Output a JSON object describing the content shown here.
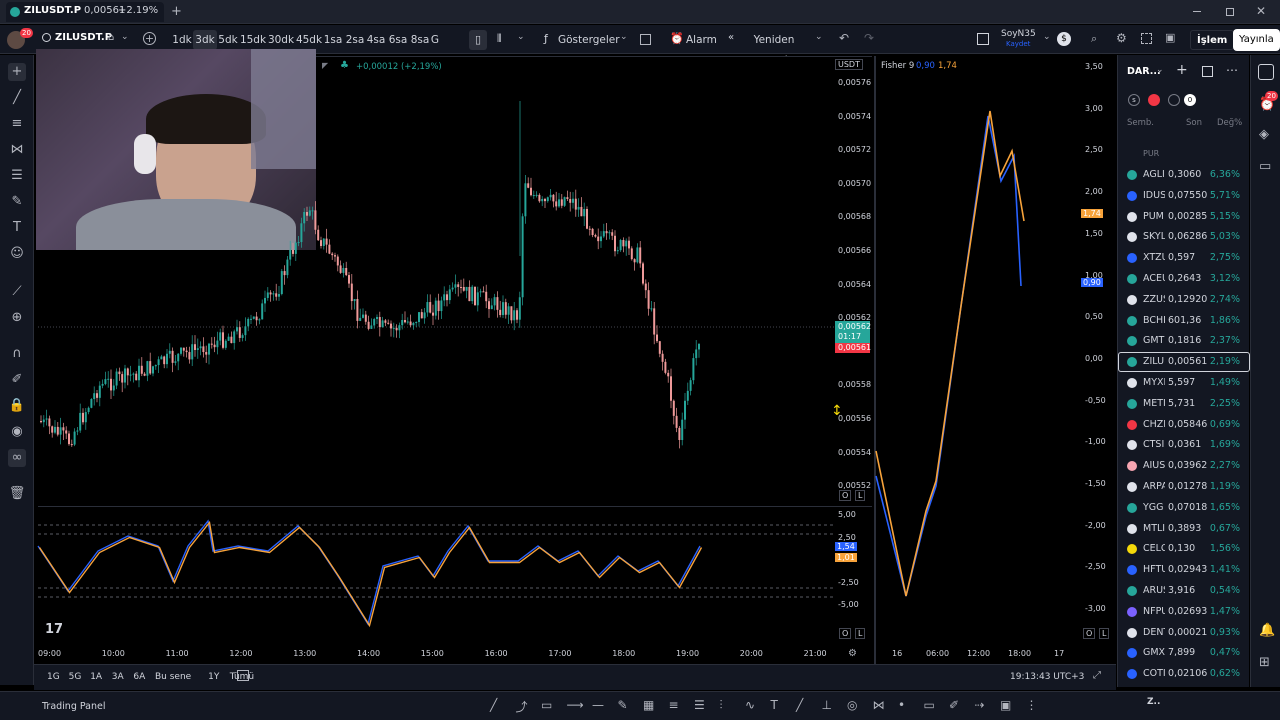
{
  "tab": {
    "title": "ZILUSDT.P",
    "price": "0,00561",
    "change": "+2.19%",
    "plus": "+"
  },
  "toolbar": {
    "symbol": "ZILUSDT.P",
    "intervals": [
      "1dk",
      "3dk",
      "5dk",
      "15dk",
      "30dk",
      "45dk",
      "1sa",
      "2sa",
      "4sa",
      "6sa",
      "8sa",
      "G"
    ],
    "active_interval": "3dk",
    "indicators": "Göstergeler",
    "alarm": "Alarm",
    "replay": "Yeniden oynat",
    "user": "SoyN35",
    "user_sub": "Kaydet",
    "trade": "İşlem",
    "publish": "Yayınla"
  },
  "chart": {
    "change_label": "+0,00012 (+2,19%)",
    "currency": "USDT",
    "price_ticks": [
      "0,00576",
      "0,00574",
      "0,00572",
      "0,00570",
      "0,00568",
      "0,00566",
      "0,00564",
      "0,00562",
      "0,00560",
      "0,00558",
      "0,00556",
      "0,00554",
      "0,00552"
    ],
    "last_price": "0,00562",
    "countdown": "01:17",
    "bid_price": "0,00561",
    "osc_ticks": [
      "5,00",
      "2,50",
      "-2,50",
      "-5,00"
    ],
    "osc_val1": "1,54",
    "osc_val2": "1,01",
    "time_ticks": [
      "09:00",
      "10:00",
      "11:00",
      "12:00",
      "13:00",
      "14:00",
      "15:00",
      "16:00",
      "17:00",
      "18:00",
      "19:00",
      "20:00",
      "21:00"
    ],
    "lock_label": "O",
    "log_label": "L"
  },
  "fisher": {
    "title": "Fisher 9",
    "val1": "0,90",
    "val2": "1,74",
    "ticks": [
      "3,50",
      "3,00",
      "2,50",
      "2,00",
      "1,50",
      "1,00",
      "0,50",
      "0,00",
      "-0,50",
      "-1,00",
      "-1,50",
      "-2,00",
      "-2,50",
      "-3,00"
    ],
    "label_orange": "1,74",
    "label_blue": "0,90",
    "time_ticks": [
      "16",
      "06:00",
      "12:00",
      "18:00",
      "17"
    ],
    "lock_label": "O",
    "log_label": "L"
  },
  "ranges": {
    "items": [
      "1G",
      "5G",
      "1A",
      "3A",
      "6A",
      "Bu sene",
      "1Y",
      "Tümü"
    ],
    "clock": "19:13:43 UTC+3"
  },
  "bottom": {
    "panel": "Trading Panel"
  },
  "watchlist": {
    "title": "DAR...",
    "cols": [
      "Semb.",
      "Son",
      "Değ%"
    ],
    "top_partial": "PUR",
    "rows": [
      {
        "sym": "AGLI",
        "last": "0,3060",
        "chg": "6,36%",
        "color": "#26a69a"
      },
      {
        "sym": "IDUS",
        "last": "0,07550",
        "chg": "5,71%",
        "color": "#2962ff"
      },
      {
        "sym": "PUM",
        "last": "0,00285",
        "chg": "5,15%",
        "color": "#e0e3eb"
      },
      {
        "sym": "SKYL",
        "last": "0,06286",
        "chg": "5,03%",
        "color": "#e0e3eb"
      },
      {
        "sym": "XTZU",
        "last": "0,597",
        "chg": "2,75%",
        "color": "#2962ff"
      },
      {
        "sym": "ACEU",
        "last": "0,2643",
        "chg": "3,12%",
        "color": "#26a69a"
      },
      {
        "sym": "ZZUS",
        "last": "0,12920",
        "chg": "2,74%",
        "color": "#e0e3eb"
      },
      {
        "sym": "BCHI",
        "last": "601,36",
        "chg": "1,86%",
        "color": "#26a69a"
      },
      {
        "sym": "GMT",
        "last": "0,1816",
        "chg": "2,37%",
        "color": "#26a69a"
      },
      {
        "sym": "ZILU",
        "last": "0,00561",
        "chg": "2,19%",
        "color": "#26a69a"
      },
      {
        "sym": "MYXI",
        "last": "5,597",
        "chg": "1,49%",
        "color": "#e0e3eb"
      },
      {
        "sym": "METI",
        "last": "5,731",
        "chg": "2,25%",
        "color": "#26a69a"
      },
      {
        "sym": "CHZI",
        "last": "0,05846",
        "chg": "0,69%",
        "color": "#f23645"
      },
      {
        "sym": "CTSI",
        "last": "0,0361",
        "chg": "1,69%",
        "color": "#e0e3eb"
      },
      {
        "sym": "AIUS",
        "last": "0,03962",
        "chg": "2,27%",
        "color": "#f7a6b2"
      },
      {
        "sym": "ARPA",
        "last": "0,01278",
        "chg": "1,19%",
        "color": "#e0e3eb"
      },
      {
        "sym": "YGG",
        "last": "0,07018",
        "chg": "1,65%",
        "color": "#26a69a"
      },
      {
        "sym": "MTLI",
        "last": "0,3893",
        "chg": "0,67%",
        "color": "#e0e3eb"
      },
      {
        "sym": "CELC",
        "last": "0,130",
        "chg": "1,56%",
        "color": "#f5d90a"
      },
      {
        "sym": "HFTU",
        "last": "0,02943",
        "chg": "1,41%",
        "color": "#2962ff"
      },
      {
        "sym": "ARUS",
        "last": "3,916",
        "chg": "0,54%",
        "color": "#26a69a"
      },
      {
        "sym": "NFPU",
        "last": "0,02693",
        "chg": "1,47%",
        "color": "#7b61ff"
      },
      {
        "sym": "DENT",
        "last": "0,00021",
        "chg": "0,93%",
        "color": "#e0e3eb"
      },
      {
        "sym": "GMX",
        "last": "7,899",
        "chg": "0,47%",
        "color": "#2962ff"
      },
      {
        "sym": "COTI",
        "last": "0,02106",
        "chg": "0,62%",
        "color": "#2962ff"
      }
    ],
    "selected": "ZILU",
    "footer_sym": "Z.."
  },
  "badges": {
    "alerts": "20",
    "avatar_count": "20",
    "zero": "0"
  },
  "colors": {
    "up": "#26a69a",
    "down": "#ef9a9a",
    "blue": "#2962ff",
    "orange": "#f7a33b",
    "accent": "#2962ff"
  }
}
